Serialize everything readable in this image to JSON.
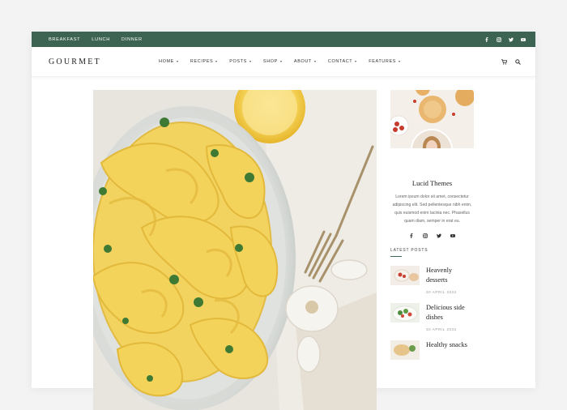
{
  "topbar": {
    "links": [
      "BREAKFAST",
      "LUNCH",
      "DINNER"
    ],
    "social_icons": [
      "facebook-icon",
      "instagram-icon",
      "twitter-icon",
      "youtube-icon"
    ],
    "color": "#3d6453"
  },
  "header": {
    "logo": "GOURMET",
    "menu": [
      "HOME",
      "RECIPES",
      "POSTS",
      "SHOP",
      "ABOUT",
      "CONTACT",
      "FEATURES"
    ],
    "icons": [
      "cart-icon",
      "search-icon"
    ]
  },
  "hero": {
    "image": "pasta-dish-photo"
  },
  "sidebar": {
    "name": "Lucid Themes",
    "bio": "Lorem ipsum dolor sit amet, consectetur adipiscing elit. Sed pellentesque nibh enim, quis euismod enim lacinia nec. Phasellus quam diam, semper in erat eu.",
    "social_icons": [
      "facebook-icon",
      "instagram-icon",
      "twitter-icon",
      "youtube-icon"
    ],
    "latest_posts_heading": "LATEST POSTS",
    "posts": [
      {
        "title": "Heavenly desserts",
        "date": "30 APRIL 2022"
      },
      {
        "title": "Delicious side dishes",
        "date": "30 APRIL 2022"
      },
      {
        "title": "Healthy snacks",
        "date": ""
      }
    ]
  }
}
